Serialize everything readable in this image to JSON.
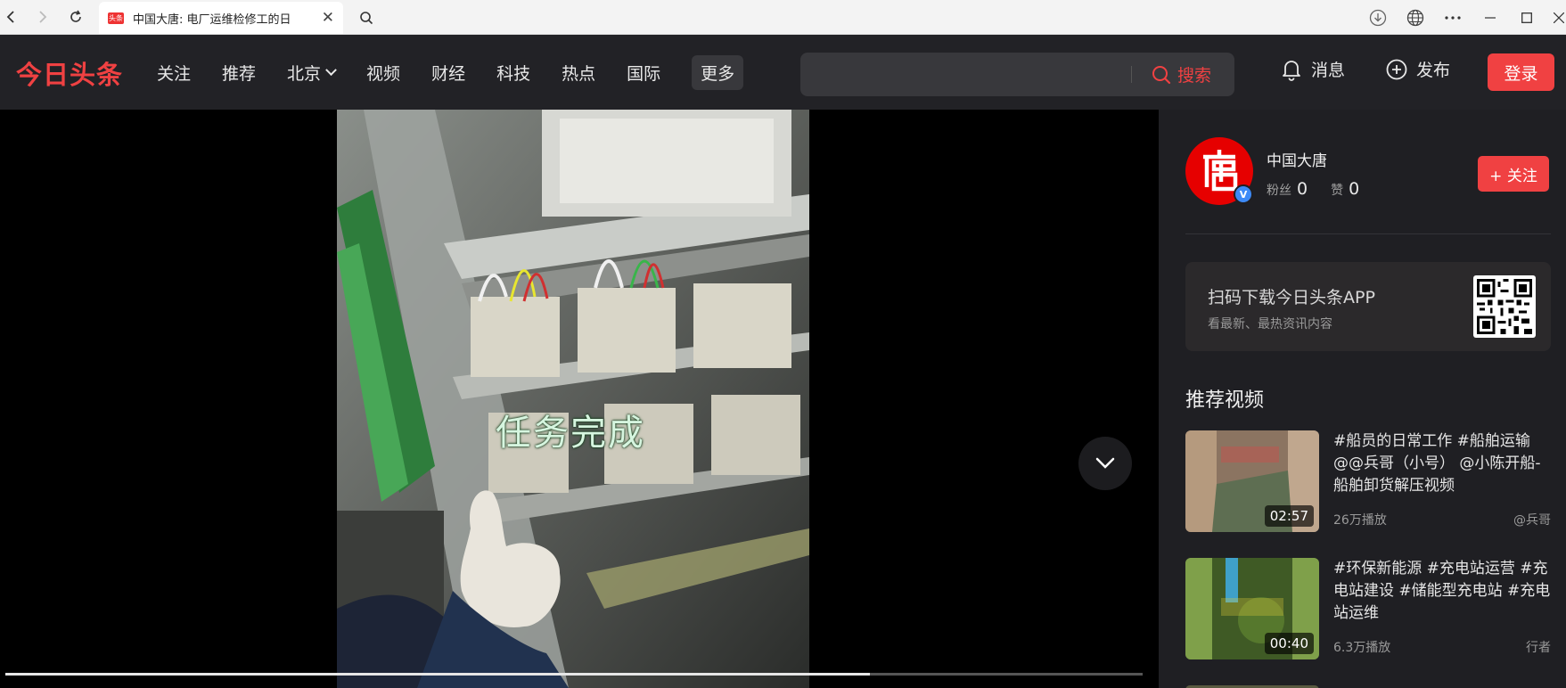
{
  "browser": {
    "tab_favicon_text": "头条",
    "tab_title": "中国大唐: 电厂运维检修工的日",
    "icons": [
      "back-icon",
      "forward-icon",
      "reload-icon",
      "close-icon",
      "search-icon",
      "download-icon",
      "globe-icon",
      "more-icon",
      "minimize-icon",
      "maximize-icon",
      "window-close-icon"
    ]
  },
  "header": {
    "logo": "今日头条",
    "nav": [
      "关注",
      "推荐",
      "北京",
      "视频",
      "财经",
      "科技",
      "热点",
      "国际"
    ],
    "more": "更多",
    "search_placeholder": "",
    "search_button": "搜索",
    "messages": "消息",
    "publish": "发布",
    "login": "登录"
  },
  "video": {
    "caption": "任务完成",
    "progress": 0.76
  },
  "author": {
    "name": "中国大唐",
    "badge": "V",
    "fans_label": "粉丝",
    "fans_count": "0",
    "likes_label": "赞",
    "likes_count": "0",
    "follow_button": "+ 关注"
  },
  "app_card": {
    "title": "扫码下载今日头条APP",
    "subtitle": "看最新、最热资讯内容"
  },
  "recommend": {
    "title": "推荐视频",
    "items": [
      {
        "title": "#船员的日常工作 #船舶运输 @@兵哥（小号） @小陈开船-船舶卸货解压视频",
        "duration": "02:57",
        "views": "26万播放",
        "author": "@兵哥"
      },
      {
        "title": "#环保新能源 #充电站运营 #充电站建设 #储能型充电站 #充电站运维",
        "duration": "00:40",
        "views": "6.3万播放",
        "author": "行者"
      }
    ]
  },
  "colors": {
    "brand_red": "#f04142",
    "header_bg": "#222226",
    "sidebar_bg": "#1f1f23"
  }
}
